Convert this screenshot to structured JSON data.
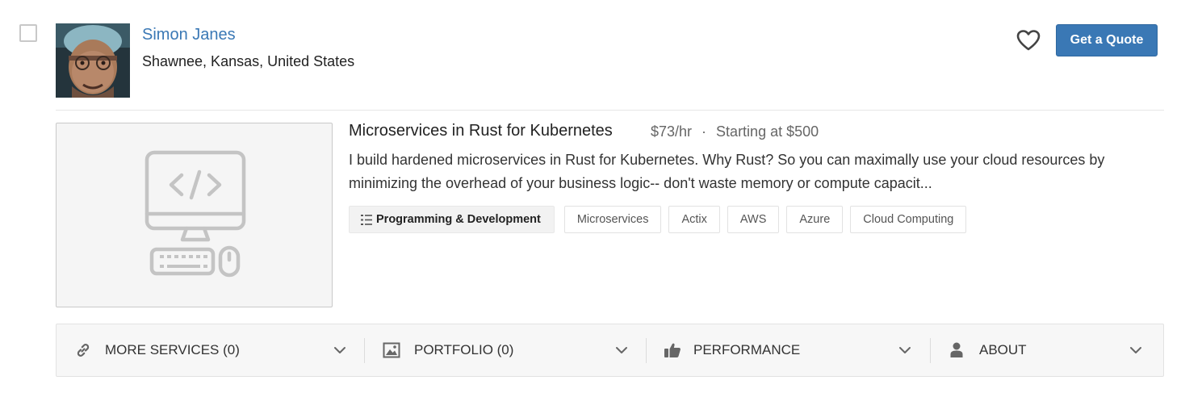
{
  "profile": {
    "name": "Simon Janes",
    "location": "Shawnee, Kansas, United States",
    "quote_button": "Get a Quote",
    "favorite_icon": "heart-outline-icon"
  },
  "service": {
    "thumbnail_icon": "computer-code-icon",
    "title": "Microservices in Rust for Kubernetes",
    "rate": "$73/hr",
    "separator": "·",
    "starting": "Starting at $500",
    "description": "I build hardened microservices in Rust for Kubernetes. Why Rust? So you can maximally use your cloud resources by minimizing the overhead of your business logic-- don't waste memory or compute capacit..."
  },
  "tags": {
    "category": "Programming & Development",
    "skills": [
      "Microservices",
      "Actix",
      "AWS",
      "Azure",
      "Cloud Computing"
    ]
  },
  "sections": [
    {
      "label": "MORE SERVICES (0)",
      "icon": "link-icon"
    },
    {
      "label": "PORTFOLIO (0)",
      "icon": "image-icon"
    },
    {
      "label": "PERFORMANCE",
      "icon": "thumbs-up-icon"
    },
    {
      "label": "ABOUT",
      "icon": "user-icon"
    }
  ],
  "colors": {
    "accent": "#3a78b5",
    "text": "#333333",
    "muted": "#666666",
    "bar_bg": "#f7f7f7"
  }
}
